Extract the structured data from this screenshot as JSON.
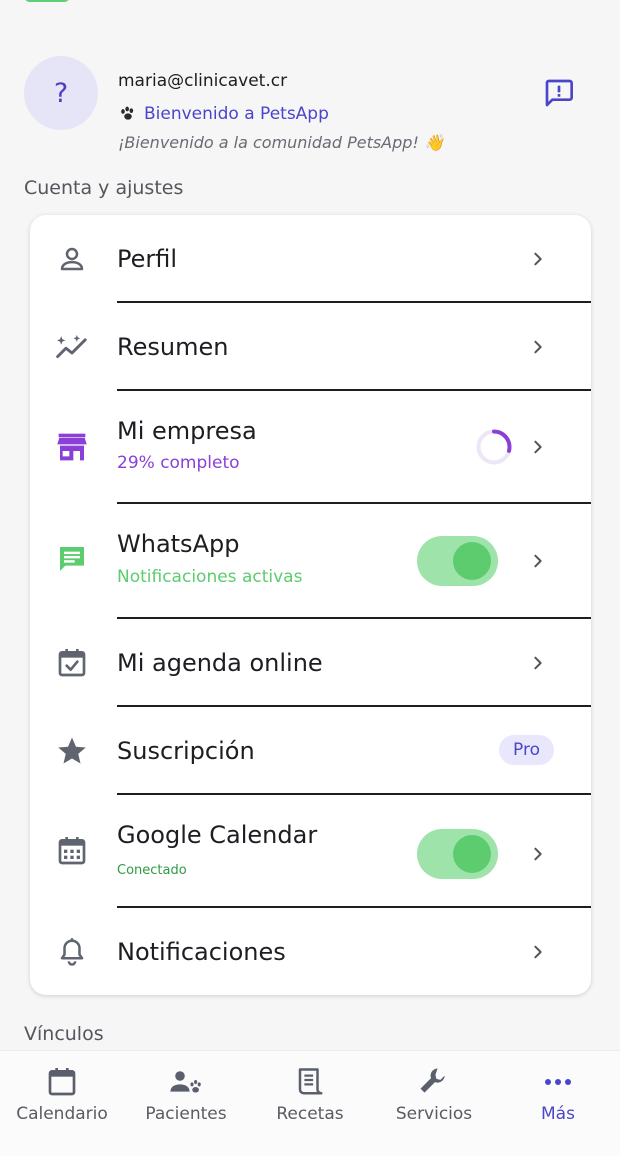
{
  "header": {
    "avatar_placeholder": "?",
    "email": "maria@clinicavet.cr",
    "welcome_title": "Bienvenido a PetsApp",
    "welcome_subtitle": "¡Bienvenido a la comunidad PetsApp! 👋"
  },
  "sections": {
    "account": "Cuenta y ajustes",
    "links": "Vínculos"
  },
  "menu": {
    "profile": {
      "label": "Perfil",
      "icon": "person-icon"
    },
    "summary": {
      "label": "Resumen",
      "icon": "sparkle-trend-icon"
    },
    "company": {
      "label": "Mi empresa",
      "status": "29% completo",
      "progress": 0.29,
      "icon": "store-icon"
    },
    "whatsapp": {
      "label": "WhatsApp",
      "status": "Notificaciones activas",
      "enabled": true,
      "icon": "chat-icon"
    },
    "agenda": {
      "label": "Mi agenda online",
      "icon": "calendar-check-icon"
    },
    "subscription": {
      "label": "Suscripción",
      "badge": "Pro",
      "icon": "star-icon"
    },
    "google_calendar": {
      "label": "Google Calendar",
      "status": "Conectado",
      "enabled": true,
      "icon": "calendar-grid-icon"
    },
    "notifications": {
      "label": "Notificaciones",
      "icon": "bell-icon"
    }
  },
  "tabbar": {
    "calendar": "Calendario",
    "patients": "Pacientes",
    "prescriptions": "Recetas",
    "services": "Servicios",
    "more": "Más",
    "active": "more"
  },
  "colors": {
    "accent": "#4b45c9",
    "purple": "#8a3fd6",
    "green": "#5dcc6e",
    "toggle_track": "#9ee3a9",
    "icon_gray": "#5f6470"
  }
}
